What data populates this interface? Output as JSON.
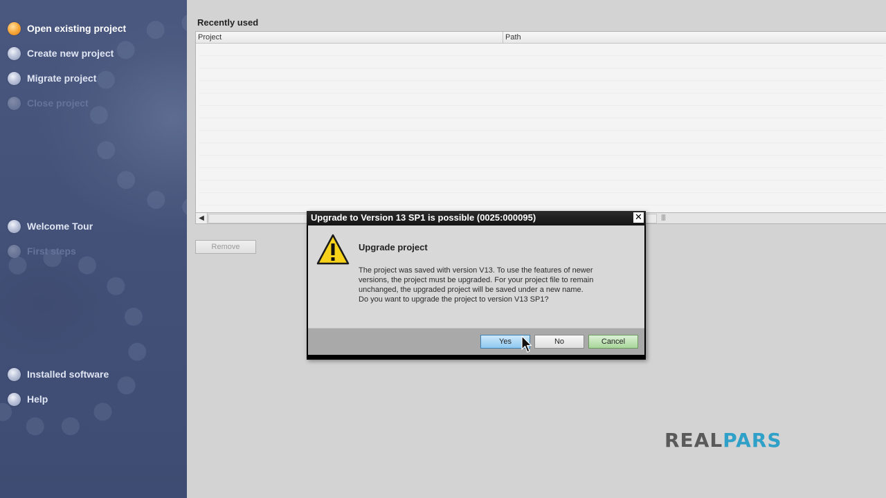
{
  "sidebar": {
    "items": [
      {
        "label": "Open existing project",
        "state": "active"
      },
      {
        "label": "Create new project",
        "state": "normal"
      },
      {
        "label": "Migrate project",
        "state": "normal"
      },
      {
        "label": "Close project",
        "state": "disabled"
      },
      {
        "label": "Welcome Tour",
        "state": "normal"
      },
      {
        "label": "First steps",
        "state": "disabled"
      },
      {
        "label": "Installed software",
        "state": "normal"
      },
      {
        "label": "Help",
        "state": "normal"
      }
    ]
  },
  "main": {
    "section_title": "Recently used",
    "table": {
      "columns": [
        "Project",
        "Path"
      ],
      "rows": []
    },
    "remove_label": "Remove"
  },
  "dialog": {
    "title": "Upgrade to Version 13 SP1 is possible (0025:000095)",
    "close_glyph": "✕",
    "heading": "Upgrade project",
    "message_lines": [
      "The project was saved with version V13. To use the features of newer",
      "versions, the project must be upgraded. For your project file to remain",
      "unchanged, the upgraded project will be saved under a new name.",
      "Do you want to upgrade the project to version V13 SP1?"
    ],
    "buttons": {
      "yes": "Yes",
      "no": "No",
      "cancel": "Cancel"
    },
    "icon": "warning-icon"
  },
  "logo": {
    "part1": "REAL",
    "part2": "PARS"
  },
  "colors": {
    "sidebar": "#44527a",
    "active_dot": "#f7a83a",
    "accent_logo": "#2fa0c8"
  }
}
